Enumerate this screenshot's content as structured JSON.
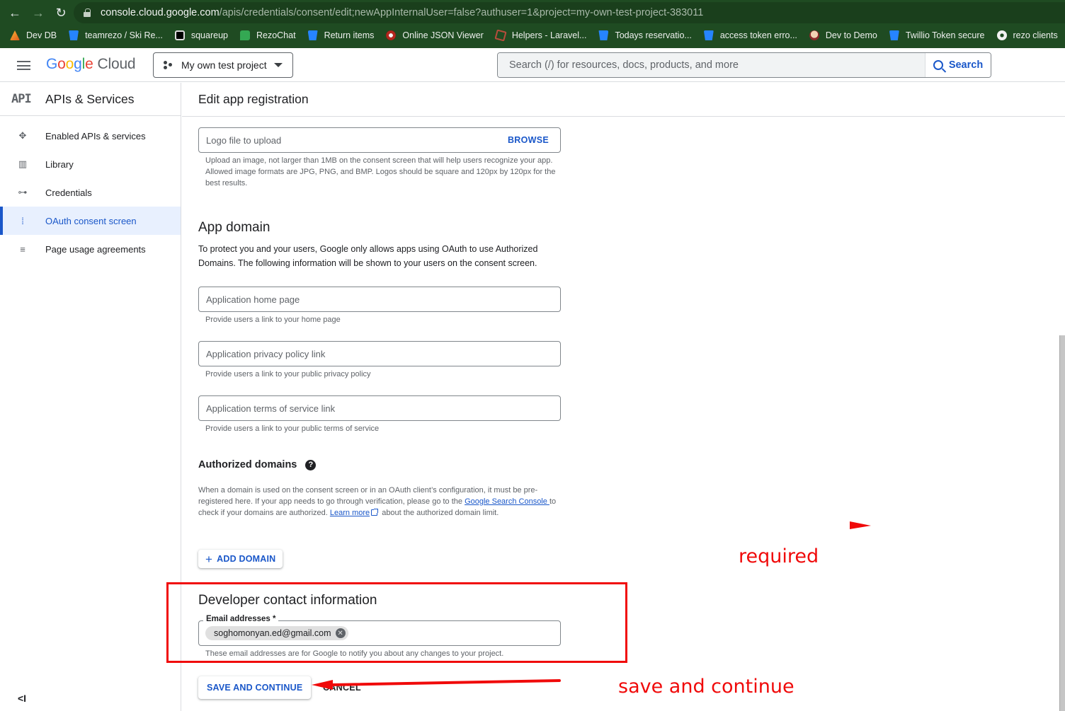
{
  "browser": {
    "url_host": "console.cloud.google.com",
    "url_path": "/apis/credentials/consent/edit;newAppInternalUser=false?authuser=1&project=my-own-test-project-383011",
    "bookmarks": [
      {
        "label": "Dev DB",
        "icon": "devdb-icon"
      },
      {
        "label": "teamrezo / Ski Re...",
        "icon": "bitbucket-icon"
      },
      {
        "label": "squareup",
        "icon": "square-icon"
      },
      {
        "label": "RezoChat",
        "icon": "chat-icon"
      },
      {
        "label": "Return items",
        "icon": "bitbucket-icon"
      },
      {
        "label": "Online JSON Viewer",
        "icon": "json-viewer-icon"
      },
      {
        "label": "Helpers - Laravel...",
        "icon": "laravel-icon"
      },
      {
        "label": "Todays reservatio...",
        "icon": "bitbucket-icon"
      },
      {
        "label": "access token erro...",
        "icon": "bitbucket-icon"
      },
      {
        "label": "Dev to Demo",
        "icon": "jenkins-icon"
      },
      {
        "label": "Twillio Token secure",
        "icon": "bitbucket-icon"
      },
      {
        "label": "rezo clients",
        "icon": "globe-icon"
      }
    ]
  },
  "topbar": {
    "logo_google": [
      "G",
      "o",
      "o",
      "g",
      "l",
      "e"
    ],
    "logo_cloud": "Cloud",
    "project_name": "My own test project",
    "search_placeholder": "Search (/) for resources, docs, products, and more",
    "search_button": "Search"
  },
  "sidenav": {
    "badge": "API",
    "title": "APIs & Services",
    "items": [
      {
        "label": "Enabled APIs & services",
        "icon": "✥",
        "active": false
      },
      {
        "label": "Library",
        "icon": "▥",
        "active": false
      },
      {
        "label": "Credentials",
        "icon": "⊶",
        "active": false
      },
      {
        "label": "OAuth consent screen",
        "icon": "⁞",
        "active": true
      },
      {
        "label": "Page usage agreements",
        "icon": "≡",
        "active": false
      }
    ],
    "collapse_glyph": "<I"
  },
  "page": {
    "title": "Edit app registration",
    "logo_field": {
      "placeholder": "Logo file to upload",
      "browse": "BROWSE",
      "hint": "Upload an image, not larger than 1MB on the consent screen that will help users recognize your app. Allowed image formats are JPG, PNG, and BMP. Logos should be square and 120px by 120px for the best results."
    },
    "app_domain": {
      "heading": "App domain",
      "description": "To protect you and your users, Google only allows apps using OAuth to use Authorized Domains. The following information will be shown to your users on the consent screen.",
      "home_page": {
        "placeholder": "Application home page",
        "hint": "Provide users a link to your home page"
      },
      "privacy": {
        "placeholder": "Application privacy policy link",
        "hint": "Provide users a link to your public privacy policy"
      },
      "tos": {
        "placeholder": "Application terms of service link",
        "hint": "Provide users a link to your public terms of service"
      }
    },
    "authorized_domains": {
      "heading": "Authorized domains",
      "help_glyph": "?",
      "text_1": "When a domain is used on the consent screen or in an OAuth client’s configuration, it must be pre-registered here. If your app needs to go through verification, please go to the ",
      "link_console": "Google Search Console ",
      "text_2": "to check if your domains are authorized. ",
      "link_learn": "Learn more",
      "text_3": " about the authorized domain limit.",
      "add_button": "ADD DOMAIN"
    },
    "developer_contact": {
      "heading": "Developer contact information",
      "label": "Email addresses *",
      "emails": [
        "soghomonyan.ed@gmail.com"
      ],
      "hint": "These email addresses are for Google to notify you about any changes to your project."
    },
    "actions": {
      "save": "SAVE AND CONTINUE",
      "cancel": "CANCEL"
    }
  },
  "annotations": {
    "color": "#f00a0a",
    "required_label": "required",
    "save_label": "save and continue"
  }
}
